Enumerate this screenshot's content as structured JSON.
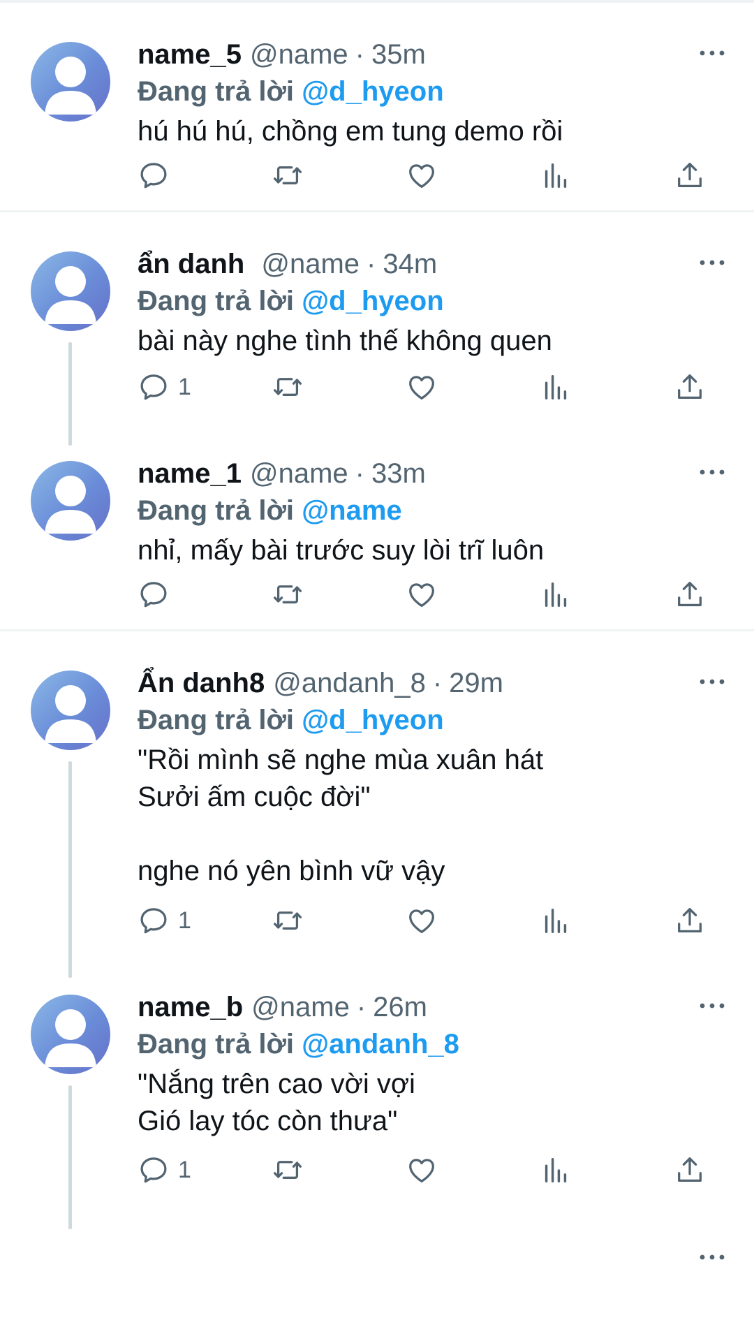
{
  "replying_prefix": "Đang trả lời",
  "colors": {
    "accent": "#1d9bf0",
    "muted": "#536471",
    "divider": "#eff3f4"
  },
  "icons": [
    "more-icon",
    "reply-icon",
    "retweet-icon",
    "like-icon",
    "views-icon",
    "share-icon",
    "avatar-default-icon"
  ],
  "tweets": [
    {
      "name": "name_5",
      "handle": "@name",
      "sep": "·",
      "time": "35m",
      "reply_to": "@d_hyeon",
      "text": "hú hú hú, chồng em tung demo rồi",
      "reply_count": ""
    },
    {
      "name": "ẩn danh",
      "handle": "@name",
      "sep": "·",
      "time": "34m",
      "reply_to": "@d_hyeon",
      "text": "bài này nghe tình thế không quen",
      "reply_count": "1"
    },
    {
      "name": "name_1",
      "handle": "@name",
      "sep": "·",
      "time": "33m",
      "reply_to": "@name",
      "text": "nhỉ, mấy bài trước suy lòi trĩ luôn",
      "reply_count": ""
    },
    {
      "name": "Ẩn danh8",
      "handle": "@andanh_8",
      "sep": "·",
      "time": "29m",
      "reply_to": "@d_hyeon",
      "text": "\"Rồi mình sẽ nghe mùa xuân hát\nSưởi ấm cuộc đời\"\n\nnghe nó yên bình vữ vậy",
      "reply_count": "1"
    },
    {
      "name": "name_b",
      "handle": "@name",
      "sep": "·",
      "time": "26m",
      "reply_to": "@andanh_8",
      "text": "\"Nắng trên cao vời vợi\nGió lay tóc còn thưa\"",
      "reply_count": "1"
    }
  ]
}
